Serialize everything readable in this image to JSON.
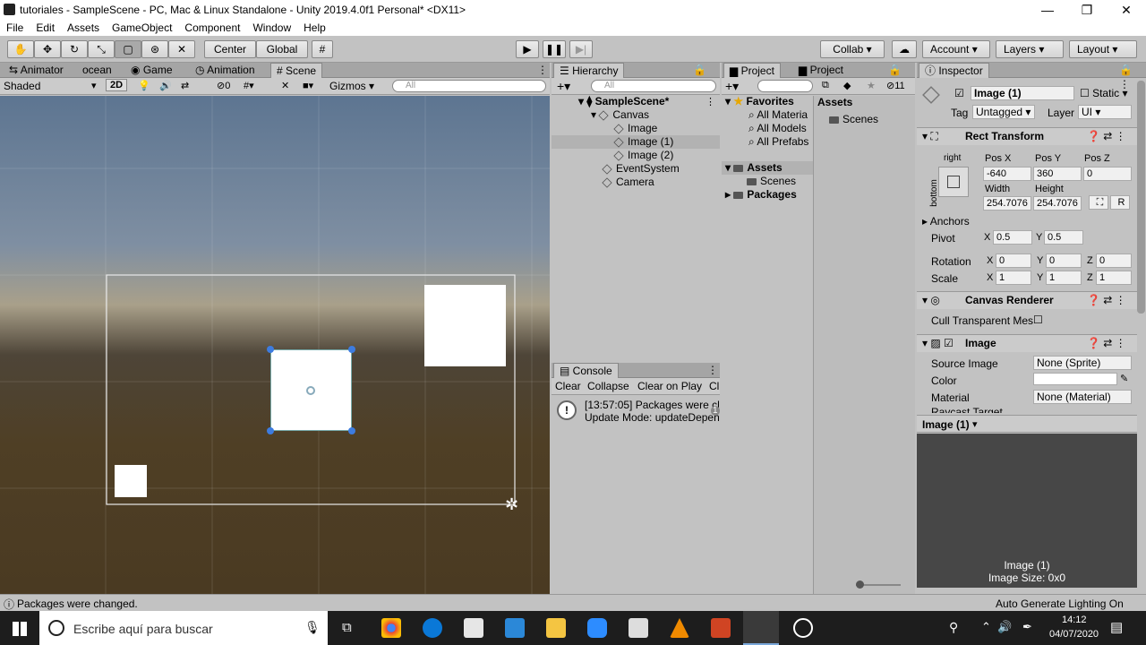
{
  "window": {
    "title": "tutoriales - SampleScene - PC, Mac & Linux Standalone - Unity 2019.4.0f1 Personal* <DX11>",
    "minimize": "—",
    "restore": "❐",
    "close": "✕"
  },
  "menu": [
    "File",
    "Edit",
    "Assets",
    "GameObject",
    "Component",
    "Window",
    "Help"
  ],
  "toolbar": {
    "pivot": "Center",
    "space": "Global",
    "collab": "Collab",
    "account": "Account",
    "layers": "Layers",
    "layout": "Layout",
    "play_icon": "play-icon",
    "pause_icon": "pause-icon",
    "step_icon": "step-icon"
  },
  "scene_tabs": [
    "Animator",
    "ocean",
    "Game",
    "Animation",
    "Scene"
  ],
  "scene_bar": {
    "shading": "Shaded",
    "mode_2d": "2D",
    "hidden_count": "0",
    "gizmos": "Gizmos",
    "search_placeholder": "All"
  },
  "hierarchy": {
    "tab": "Hierarchy",
    "search_placeholder": "All",
    "scene": "SampleScene*",
    "items": [
      "Canvas",
      "Image",
      "Image (1)",
      "Image (2)",
      "EventSystem",
      "Camera"
    ]
  },
  "console": {
    "tab": "Console",
    "buttons": [
      "Clear",
      "Collapse",
      "Clear on Play",
      "Cl"
    ],
    "message_line1": "[13:57:05] Packages were ch",
    "message_line2": "Update Mode: updateDepen",
    "count": "1"
  },
  "project": {
    "tabs": [
      "Project",
      "Project"
    ],
    "badge": "11",
    "favorites": "Favorites",
    "fav_items": [
      "All Materia",
      "All Models",
      "All Prefabs"
    ],
    "assets": "Assets",
    "asset_children": [
      "Scenes"
    ],
    "packages": "Packages",
    "right_header": "Assets",
    "right_items": [
      "Scenes"
    ]
  },
  "inspector": {
    "tab": "Inspector",
    "object_name": "Image (1)",
    "static": "Static",
    "tag_label": "Tag",
    "tag": "Untagged",
    "layer_label": "Layer",
    "layer": "UI",
    "rect_transform": "Rect Transform",
    "anchor_h": "right",
    "anchor_v": "bottom",
    "pos_x_label": "Pos X",
    "pos_y_label": "Pos Y",
    "pos_z_label": "Pos Z",
    "pos_x": "-640",
    "pos_y": "360",
    "pos_z": "0",
    "width_label": "Width",
    "height_label": "Height",
    "width": "254.7076",
    "height": "254.7076",
    "r_btn": "R",
    "anchors": "Anchors",
    "pivot": "Pivot",
    "pivot_x": "0.5",
    "pivot_y": "0.5",
    "rotation": "Rotation",
    "rot_x": "0",
    "rot_y": "0",
    "rot_z": "0",
    "scale": "Scale",
    "scale_x": "1",
    "scale_y": "1",
    "scale_z": "1",
    "x": "X",
    "y": "Y",
    "z": "Z",
    "canvas_renderer": "Canvas Renderer",
    "cull": "Cull Transparent Mes",
    "image": "Image",
    "source_image_label": "Source Image",
    "source_image": "None (Sprite)",
    "color_label": "Color",
    "material_label": "Material",
    "material": "None (Material)",
    "raycast": "Raycast Target",
    "preview_header": "Image (1)",
    "preview_name": "Image (1)",
    "preview_size": "Image Size: 0x0"
  },
  "status": {
    "message": "Packages were changed.",
    "lighting": "Auto Generate Lighting On"
  },
  "taskbar": {
    "search": "Escribe aquí para buscar",
    "time": "14:12",
    "date": "04/07/2020"
  }
}
